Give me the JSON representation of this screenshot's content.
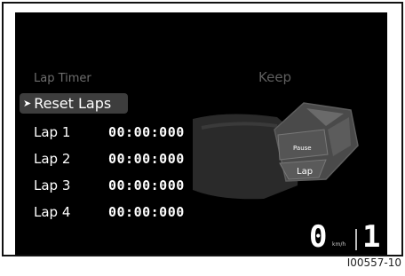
{
  "screen": {
    "title": "Lap Timer",
    "keep_label": "Keep",
    "menu": {
      "selected_item": "Reset Laps"
    },
    "laps": [
      {
        "label": "Lap 1",
        "time": "00:00:000"
      },
      {
        "label": "Lap 2",
        "time": "00:00:000"
      },
      {
        "label": "Lap 3",
        "time": "00:00:000"
      },
      {
        "label": "Lap 4",
        "time": "00:00:000"
      }
    ],
    "controller": {
      "pause_label": "Pause",
      "lap_label": "Lap"
    },
    "status": {
      "speed": "0",
      "speed_unit": "km/h",
      "gear": "1"
    }
  },
  "figure_ref": "I00557-10"
}
